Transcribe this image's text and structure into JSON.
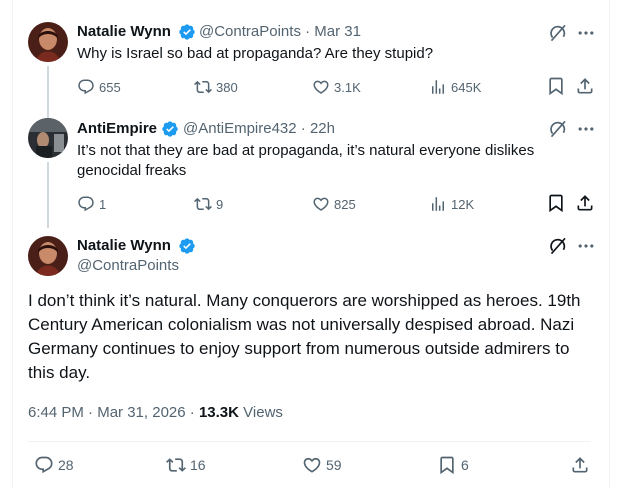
{
  "colors": {
    "verified": "#1d9bf0",
    "text": "#0f1419",
    "muted": "#536471",
    "thread_line": "#cfd9de",
    "divider": "#eff3f4"
  },
  "tweet1": {
    "name": "Natalie Wynn",
    "handle": "@ContraPoints",
    "sep": "·",
    "date": "Mar 31",
    "text": "Why is Israel so bad at propaganda? Are they stupid?",
    "replies": "655",
    "reposts": "380",
    "likes": "3.1K",
    "views": "645K"
  },
  "tweet2": {
    "name": "AntiEmpire",
    "handle": "@AntiEmpire432",
    "sep": "·",
    "date": "22h",
    "text": "It’s not that they are bad at propaganda, it’s natural everyone dislikes genocidal freaks",
    "replies": "1",
    "reposts": "9",
    "likes": "825",
    "views": "12K"
  },
  "main": {
    "name": "Natalie Wynn",
    "handle": "@ContraPoints",
    "text": "I don’t think it’s natural. Many conquerors are worshipped as heroes. 19th Century American colonialism was not universally despised abroad. Nazi Germany continues to enjoy support from numerous outside admirers to this day.",
    "time": "6:44 PM",
    "sep": "·",
    "date": "Mar 31, 2026",
    "sep2": "·",
    "views_count": "13.3K",
    "views_label": "Views",
    "replies": "28",
    "reposts": "16",
    "likes": "59",
    "bookmarks": "6"
  },
  "icons": {
    "reply": "reply-icon",
    "repost": "repost-icon",
    "like": "like-icon",
    "views": "views-icon",
    "bookmark": "bookmark-icon",
    "share": "share-icon",
    "grok": "grok-icon",
    "more": "more-icon",
    "verified": "verified-badge-icon"
  }
}
